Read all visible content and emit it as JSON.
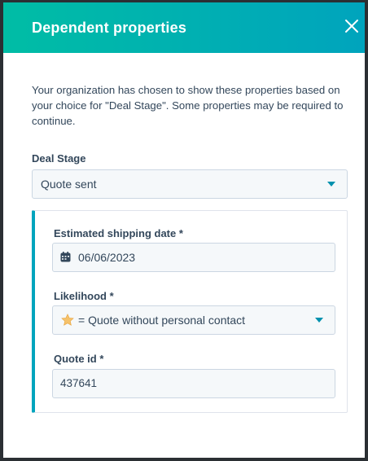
{
  "dialog": {
    "title": "Dependent properties",
    "close_icon": "close-icon",
    "intro_text": "Your organization has chosen to show these properties based on your choice for \"Deal Stage\". Some properties may be required to continue."
  },
  "deal_stage": {
    "label": "Deal Stage",
    "value": "Quote sent"
  },
  "dependent_fields": {
    "shipping_date": {
      "label": "Estimated shipping date *",
      "value": "06/06/2023",
      "icon": "calendar-icon"
    },
    "likelihood": {
      "label": "Likelihood *",
      "value": "= Quote without personal contact",
      "icon": "star-icon"
    },
    "quote_id": {
      "label": "Quote id *",
      "value": "437641"
    }
  },
  "colors": {
    "header_gradient_start": "#00bda5",
    "header_gradient_end": "#00a4bd",
    "accent": "#0091ae",
    "text": "#33475b",
    "star": "#f5c26b"
  }
}
